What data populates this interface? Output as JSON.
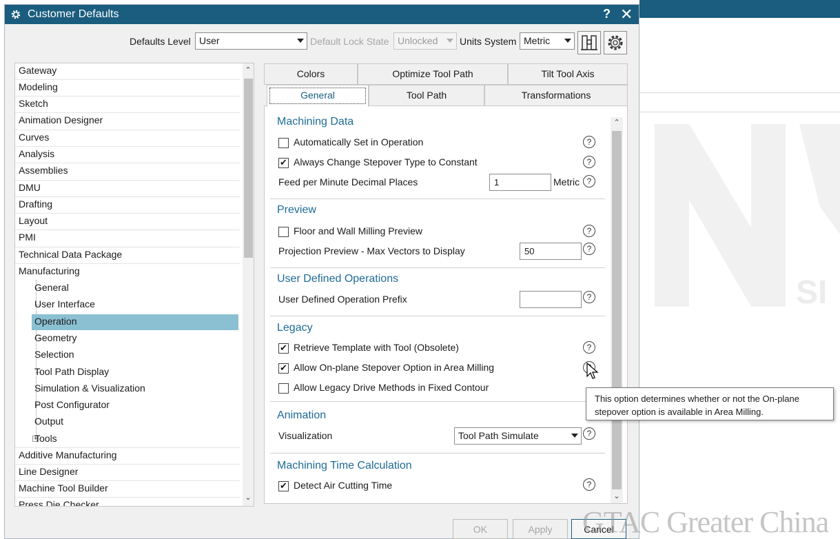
{
  "window": {
    "title": "Customer Defaults",
    "help_label": "?",
    "close_label": "✕"
  },
  "toolbar": {
    "defaults_level_label": "Defaults Level",
    "defaults_level_value": "User",
    "lock_state_label": "Default Lock State",
    "lock_state_value": "Unlocked",
    "units_label": "Units System",
    "units_value": "Metric"
  },
  "tree": {
    "items": [
      "Gateway",
      "Modeling",
      "Sketch",
      "Animation Designer",
      "Curves",
      "Analysis",
      "Assemblies",
      "DMU",
      "Drafting",
      "Layout",
      "PMI",
      "Technical Data Package",
      "Manufacturing"
    ],
    "manufacturing_children": [
      "General",
      "User Interface",
      "Operation",
      "Geometry",
      "Selection",
      "Tool Path Display",
      "Simulation & Visualization",
      "Post Configurator",
      "Output",
      "Tools"
    ],
    "items_after": [
      "Additive Manufacturing",
      "Line Designer",
      "Machine Tool Builder",
      "Press Die Checker"
    ],
    "selected": "Operation"
  },
  "tabs": {
    "row1": [
      "Colors",
      "Optimize Tool Path",
      "Tilt Tool Axis"
    ],
    "row2": [
      "General",
      "Tool Path",
      "Transformations"
    ],
    "active": "General"
  },
  "sections": {
    "machining_data": {
      "title": "Machining Data",
      "auto_set_label": "Automatically Set in Operation",
      "auto_set_checked": false,
      "always_change_label": "Always Change Stepover Type to Constant",
      "always_change_checked": true,
      "feed_label": "Feed per Minute Decimal Places",
      "feed_value": "1",
      "feed_unit": "Metric"
    },
    "preview": {
      "title": "Preview",
      "floor_wall_label": "Floor and Wall Milling Preview",
      "floor_wall_checked": false,
      "proj_label": "Projection Preview - Max Vectors to Display",
      "proj_value": "50"
    },
    "udo": {
      "title": "User Defined Operations",
      "prefix_label": "User Defined Operation Prefix",
      "prefix_value": ""
    },
    "legacy": {
      "title": "Legacy",
      "retrieve_label": "Retrieve Template with Tool (Obsolete)",
      "retrieve_checked": true,
      "allow_onplane_label": "Allow On-plane Stepover Option in Area Milling",
      "allow_onplane_checked": true,
      "allow_legacy_label": "Allow Legacy Drive Methods in Fixed Contour",
      "allow_legacy_checked": false
    },
    "animation": {
      "title": "Animation",
      "vis_label": "Visualization",
      "vis_value": "Tool Path Simulate"
    },
    "mtc": {
      "title": "Machining Time Calculation",
      "detect_label": "Detect Air Cutting Time",
      "detect_checked": true
    }
  },
  "tooltip": {
    "line1": "This option determines whether or not the On-plane",
    "line2": "stepover option is available in Area Milling."
  },
  "buttons": {
    "ok": "OK",
    "apply": "Apply",
    "cancel": "Cancel"
  },
  "watermark": "GTAC Greater China",
  "colors": {
    "accent": "#1a5d7e",
    "section_title": "#1e6b96",
    "selection": "#8bc0d3"
  }
}
